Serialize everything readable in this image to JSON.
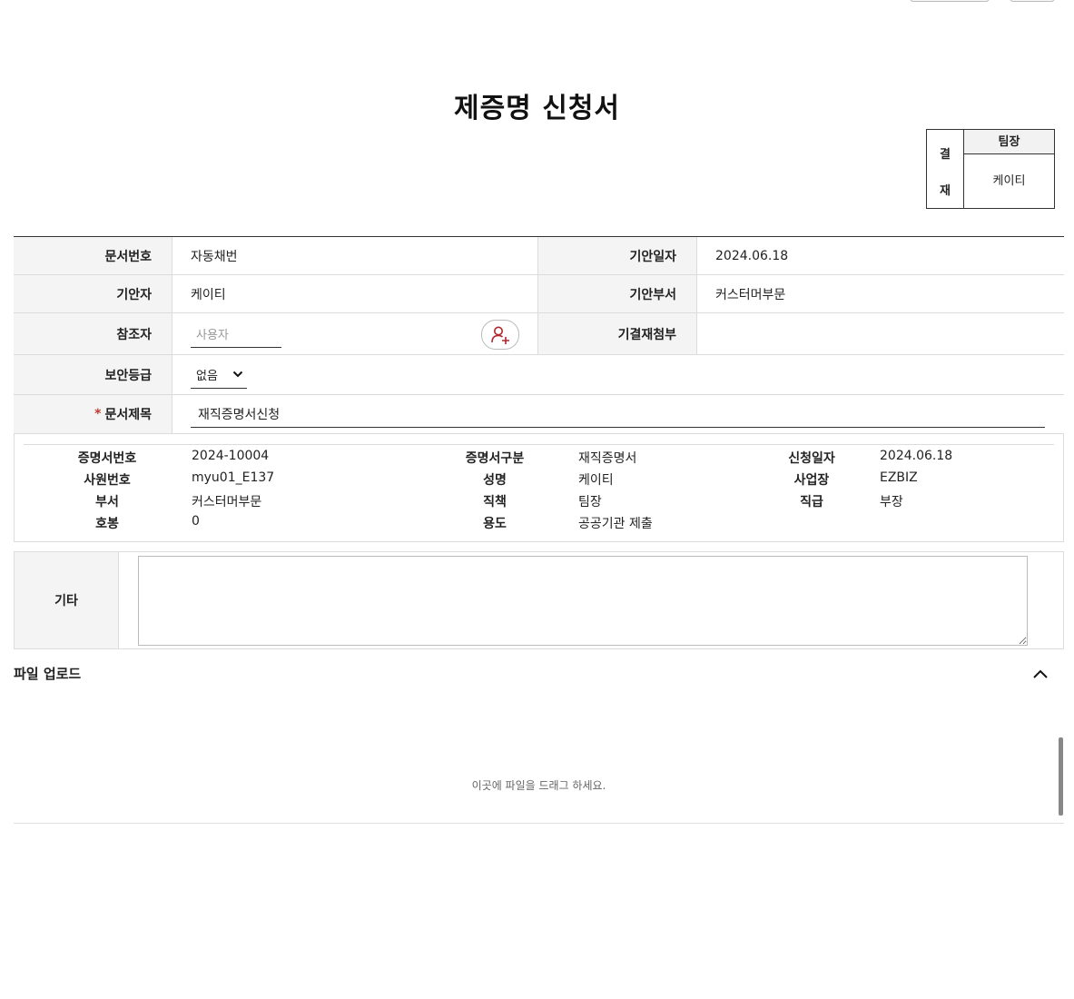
{
  "title": "제증명 신청서",
  "approval": {
    "side_top": "결",
    "side_bottom": "재",
    "role": "팀장",
    "approver": "케이티"
  },
  "form": {
    "doc_no_label": "문서번호",
    "doc_no_value": "자동채번",
    "draft_date_label": "기안일자",
    "draft_date_value": "2024.06.18",
    "drafter_label": "기안자",
    "drafter_value": "케이티",
    "draft_dept_label": "기안부서",
    "draft_dept_value": "커스터머부문",
    "ref_label": "참조자",
    "ref_placeholder": "사용자",
    "attach_label": "기결재첨부",
    "attach_value": "",
    "security_label": "보안등급",
    "security_value": "없음",
    "subject_required": "*",
    "subject_label": "문서제목",
    "subject_value": "재직증명서신청"
  },
  "certificate": {
    "cert_no_label": "증명서번호",
    "cert_no_value": "2024-10004",
    "cert_type_label": "증명서구분",
    "cert_type_value": "재직증명서",
    "apply_date_label": "신청일자",
    "apply_date_value": "2024.06.18",
    "emp_no_label": "사원번호",
    "emp_no_value": "myu01_E137",
    "name_label": "성명",
    "name_value": "케이티",
    "site_label": "사업장",
    "site_value": "EZBIZ",
    "dept_label": "부서",
    "dept_value": "커스터머부문",
    "duty_label": "직책",
    "duty_value": "팀장",
    "grade_label": "직급",
    "grade_value": "부장",
    "step_label": "호봉",
    "step_value": "0",
    "purpose_label": "용도",
    "purpose_value": "공공기관 제출"
  },
  "etc": {
    "label": "기타",
    "value": ""
  },
  "upload": {
    "title": "파일 업로드",
    "drop_text": "이곳에 파일을 드래그 하세요."
  },
  "colors": {
    "required": "#c0392b",
    "icon": "#b0262e"
  },
  "icons": {
    "add_user": "add-user-icon",
    "collapse": "chevron-up-icon",
    "select": "chevron-down-icon"
  }
}
